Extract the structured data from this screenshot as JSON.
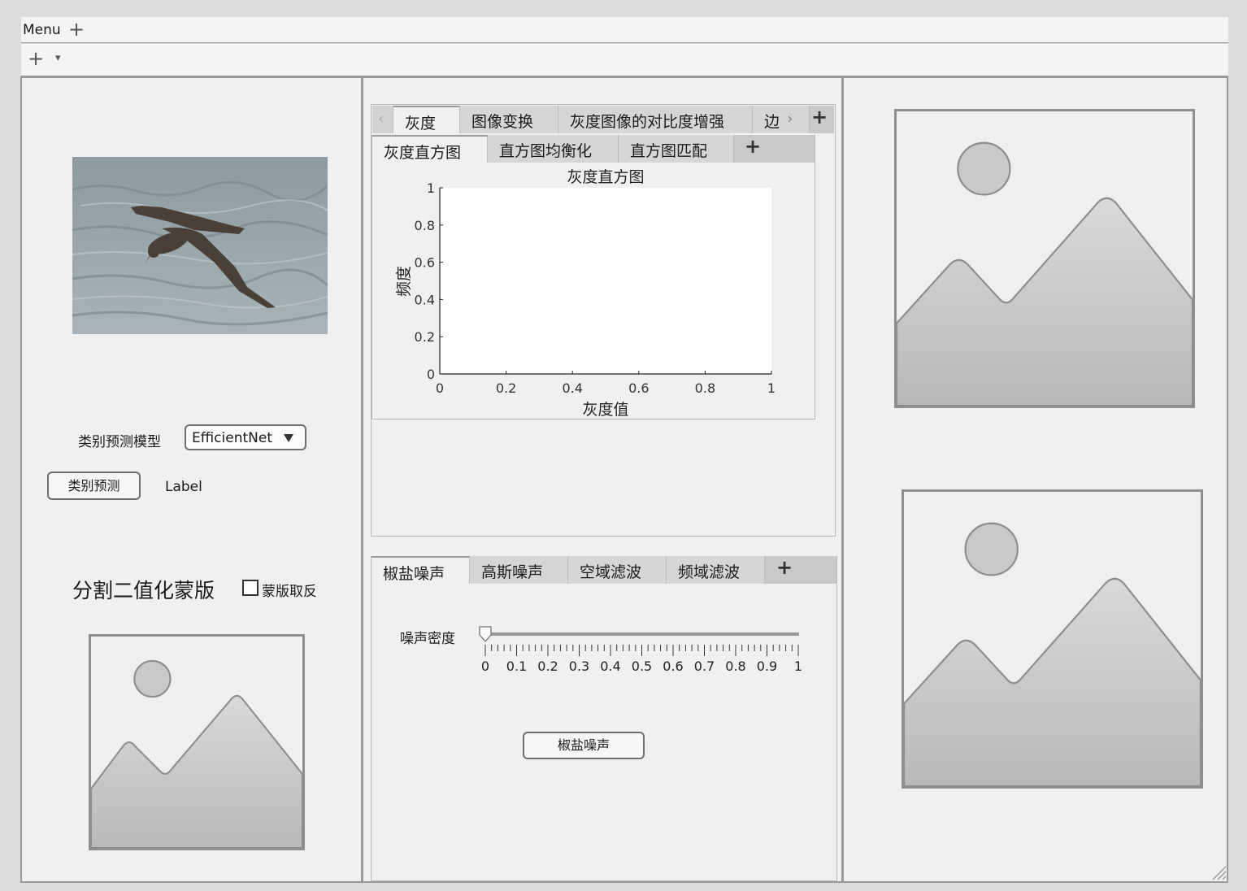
{
  "menubar": {
    "menu_label": "Menu"
  },
  "left": {
    "model_label": "类别预测模型",
    "model_selected": "EfficientNet",
    "predict_button": "类别预测",
    "prediction_label": "Label",
    "mask_title": "分割二值化蒙版",
    "invert_checkbox_label": "蒙版取反"
  },
  "top_tabs": [
    "灰度",
    "图像变换",
    "灰度图像的对比度增强",
    "边"
  ],
  "gray_subtabs": [
    "灰度直方图",
    "直方图均衡化",
    "直方图匹配"
  ],
  "noise_tabs": [
    "椒盐噪声",
    "高斯噪声",
    "空域滤波",
    "频域滤波"
  ],
  "noise_panel": {
    "density_label": "噪声密度",
    "slider_value": 0,
    "slider_ticks": [
      "0",
      "0.1",
      "0.2",
      "0.3",
      "0.4",
      "0.5",
      "0.6",
      "0.7",
      "0.8",
      "0.9",
      "1"
    ],
    "apply_button": "椒盐噪声"
  },
  "chart_data": {
    "type": "bar",
    "title": "灰度直方图",
    "xlabel": "灰度值",
    "ylabel": "频度",
    "xlim": [
      0,
      1
    ],
    "ylim": [
      0,
      1
    ],
    "x_ticks": [
      "0",
      "0.2",
      "0.4",
      "0.6",
      "0.8",
      "1"
    ],
    "y_ticks": [
      "0",
      "0.2",
      "0.4",
      "0.6",
      "0.8",
      "1"
    ],
    "categories": [],
    "values": []
  },
  "icons": {
    "add": "plus-icon",
    "dropdown": "chevron-down-icon",
    "image_placeholder": "image-placeholder-icon"
  }
}
